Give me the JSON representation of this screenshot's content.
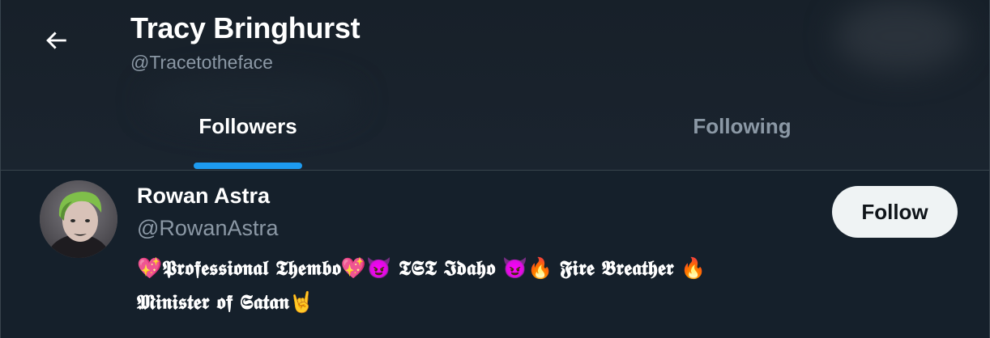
{
  "header": {
    "back_icon": "arrow-left-icon",
    "profile_name": "Tracy Bringhurst",
    "profile_handle": "@Tracetotheface"
  },
  "tabs": [
    {
      "label": "Followers",
      "active": true
    },
    {
      "label": "Following",
      "active": false
    }
  ],
  "follower": {
    "name": "Rowan Astra",
    "handle": "@RowanAstra",
    "follow_label": "Follow",
    "bio_line1": "💖𝕻𝖗𝖔𝖋𝖊𝖘𝖘𝖎𝖔𝖓𝖆𝖑 𝕿𝖍𝖊𝖒𝖇𝖔💖😈 𝕿𝕾𝕿 𝕴𝖉𝖆𝖍𝖔 😈🔥 𝕱𝖎𝖗𝖊 𝕭𝖗𝖊𝖆𝖙𝖍𝖊𝖗 🔥",
    "bio_line2": "𝕸𝖎𝖓𝖎𝖘𝖙𝖊𝖗 𝖔𝖋 𝕾𝖆𝖙𝖆𝖓🤘"
  },
  "colors": {
    "background": "#15202b",
    "accent": "#1d9bf0",
    "secondary_text": "#8b98a5",
    "divider": "#38444d",
    "follow_button_bg": "#eff3f4"
  }
}
